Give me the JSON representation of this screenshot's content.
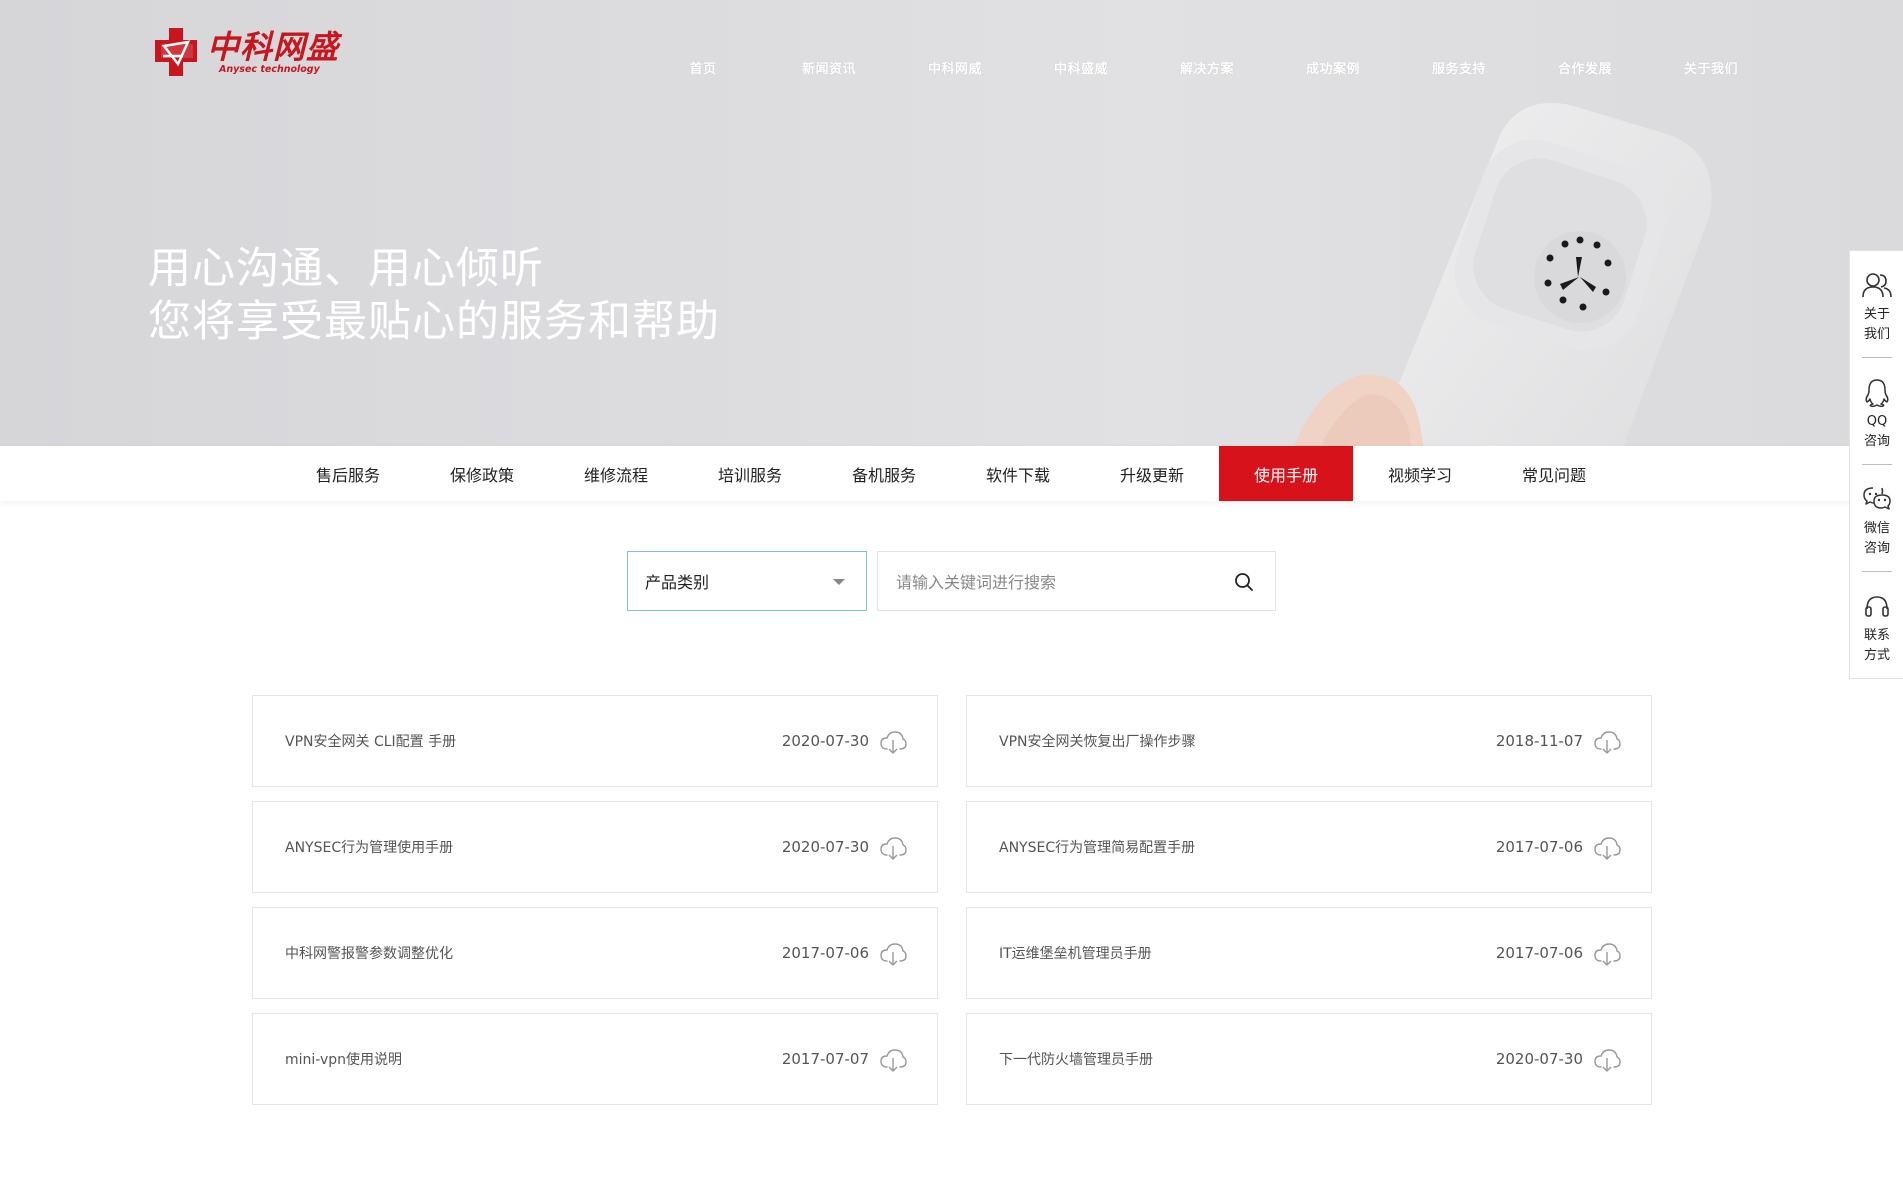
{
  "brand": {
    "name_cn": "中科网盛",
    "name_en": "Anysec technology",
    "color": "#c8161e"
  },
  "top_nav": [
    "首页",
    "新闻资讯",
    "中科网威",
    "中科盛威",
    "解决方案",
    "成功案例",
    "服务支持",
    "合作发展",
    "关于我们"
  ],
  "hero": {
    "line1": "用心沟通、用心倾听",
    "line2": "您将享受最贴心的服务和帮助"
  },
  "sub_nav": {
    "items": [
      "售后服务",
      "保修政策",
      "维修流程",
      "培训服务",
      "备机服务",
      "软件下载",
      "升级更新",
      "使用手册",
      "视频学习",
      "常见问题"
    ],
    "active": "使用手册",
    "active_color": "#d8121a"
  },
  "filter": {
    "select_label": "产品类别",
    "search_placeholder": "请输入关键词进行搜索"
  },
  "documents": [
    {
      "title": "VPN安全网关 CLI配置 手册",
      "date": "2020-07-30"
    },
    {
      "title": "VPN安全网关恢复出厂操作步骤",
      "date": "2018-11-07"
    },
    {
      "title": "ANYSEC行为管理使用手册",
      "date": "2020-07-30"
    },
    {
      "title": "ANYSEC行为管理简易配置手册",
      "date": "2017-07-06"
    },
    {
      "title": "中科网警报警参数调整优化",
      "date": "2017-07-06"
    },
    {
      "title": "IT运维堡垒机管理员手册",
      "date": "2017-07-06"
    },
    {
      "title": "mini-vpn使用说明",
      "date": "2017-07-07"
    },
    {
      "title": "下一代防火墙管理员手册",
      "date": "2020-07-30"
    }
  ],
  "side_float": [
    {
      "icon": "users-icon",
      "label": "关于我们"
    },
    {
      "icon": "qq-icon",
      "label": "QQ咨询"
    },
    {
      "icon": "wechat-icon",
      "label": "微信咨询"
    },
    {
      "icon": "headset-icon",
      "label": "联系方式"
    }
  ]
}
